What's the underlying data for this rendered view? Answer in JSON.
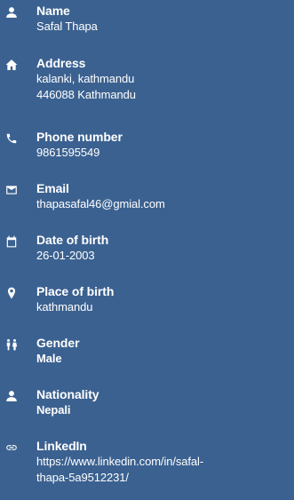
{
  "profile": {
    "name": {
      "label": "Name",
      "icon": "person-icon",
      "value": "Safal Thapa"
    },
    "address": {
      "label": "Address",
      "icon": "home-icon",
      "line1": "kalanki, kathmandu",
      "line2": "446088 Kathmandu"
    },
    "phone": {
      "label": "Phone number",
      "icon": "phone-icon",
      "value": "9861595549"
    },
    "email": {
      "label": "Email",
      "icon": "mail-icon",
      "value": "thapasafal46@gmial.com"
    },
    "dob": {
      "label": "Date of birth",
      "icon": "calendar-icon",
      "value": "26-01-2003"
    },
    "pob": {
      "label": "Place of birth",
      "icon": "location-icon",
      "value": "kathmandu"
    },
    "gender": {
      "label": "Gender",
      "icon": "gender-icon",
      "value": "Male"
    },
    "nationality": {
      "label": "Nationality",
      "icon": "person-icon",
      "value": "Nepali"
    },
    "linkedin": {
      "label": "LinkedIn",
      "icon": "link-icon",
      "line1": "https://www.linkedin.com/in/safal-",
      "line2": "thapa-5a9512231/"
    }
  },
  "colors": {
    "background": "#3b6190",
    "text": "#ffffff"
  }
}
